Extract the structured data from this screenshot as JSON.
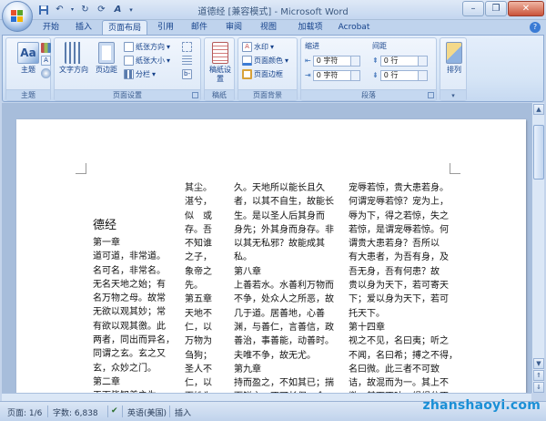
{
  "window": {
    "title": "道德经 [兼容模式] - Microsoft Word",
    "controls": [
      "minimize",
      "restore",
      "close"
    ]
  },
  "quick_access": [
    "save-icon",
    "undo-icon",
    "redo-icon",
    "refresh-icon",
    "format-icon",
    "dropdown-icon"
  ],
  "tabs": [
    {
      "label": "开始",
      "active": false
    },
    {
      "label": "插入",
      "active": false
    },
    {
      "label": "页面布局",
      "active": true
    },
    {
      "label": "引用",
      "active": false
    },
    {
      "label": "邮件",
      "active": false
    },
    {
      "label": "审阅",
      "active": false
    },
    {
      "label": "视图",
      "active": false
    },
    {
      "label": "加载项",
      "active": false
    },
    {
      "label": "Acrobat",
      "active": false
    }
  ],
  "ribbon": {
    "theme": {
      "label": "主题",
      "group": "主题"
    },
    "page_setup": {
      "group": "页面设置",
      "text_direction": "文字方向",
      "margins": "页边距",
      "orientation": "纸张方向",
      "size": "纸张大小",
      "columns": "分栏"
    },
    "manuscript": {
      "group": "稿纸",
      "button": "稿纸设置"
    },
    "page_background": {
      "group": "页面背景",
      "watermark": "水印",
      "page_color": "页面颜色",
      "page_border": "页面边框"
    },
    "paragraph": {
      "group": "段落",
      "indent": "缩进",
      "spacing": "间距",
      "indent_left": "0 字符",
      "indent_right": "0 字符",
      "spacing_before": "0 行",
      "spacing_after": "0 行"
    },
    "arrange": {
      "group": "排列",
      "button": "排列"
    }
  },
  "document": {
    "heading": "德经",
    "col1": [
      "第一章",
      "道可道，非常道。",
      "名可名，非常名。",
      "无名天地之始；有",
      "名万物之母。故常",
      "无欲以观其妙；常",
      "有欲以观其徼。此",
      "两者，同出而异名，",
      "同谓之玄。玄之又",
      "玄，众妙之门。",
      "第二章",
      "天下皆知美之为"
    ],
    "col2": [
      "其尘。",
      "湛兮，",
      "似　或",
      "存。吾",
      "不知谁",
      "之子，",
      "象帝之",
      "先。",
      "第五章",
      "天地不",
      "仁，以",
      "万物为",
      "刍狗；",
      "圣人不",
      "仁，以",
      "百姓为"
    ],
    "col3": [
      "久。天地所以能长且久",
      "者，以其不自生，故能长",
      "生。是以圣人后其身而",
      "身先；外其身而身存。非",
      "以其无私邪？故能成其",
      "私。",
      "第八章",
      "上善若水。水善利万物而",
      "不争，处众人之所恶，故",
      "几于道。居善地，心善",
      "渊，与善仁，言善信，政",
      "善治，事善能，动善时。",
      "夫唯不争，故无尤。",
      "第九章",
      "持而盈之，不如其已；揣",
      "而锐之，不可长保。金"
    ],
    "col4": [
      "宠辱若惊，贵大患若身。",
      "何谓宠辱若惊？宠为上，",
      "辱为下，得之若惊，失之",
      "若惊，是谓宠辱若惊。何",
      "谓贵大患若身？吾所以",
      "有大患者，为吾有身，及",
      "吾无身，吾有何患？故",
      "贵以身为天下，若可寄天",
      "下；爱以身为天下，若可",
      "托天下。",
      "第十四章",
      "视之不见，名曰夷；听之",
      "不闻，名曰希；搏之不得，",
      "名曰微。此三者不可致",
      "诘，故混而为一。其上不",
      "皦，其下不昧。绳绳兮不"
    ]
  },
  "status": {
    "page": "页面: 1/6",
    "words": "字数: 6,838",
    "language": "英语(美国)",
    "mode": "插入"
  },
  "watermark_text": "zhanshaoyi.com"
}
